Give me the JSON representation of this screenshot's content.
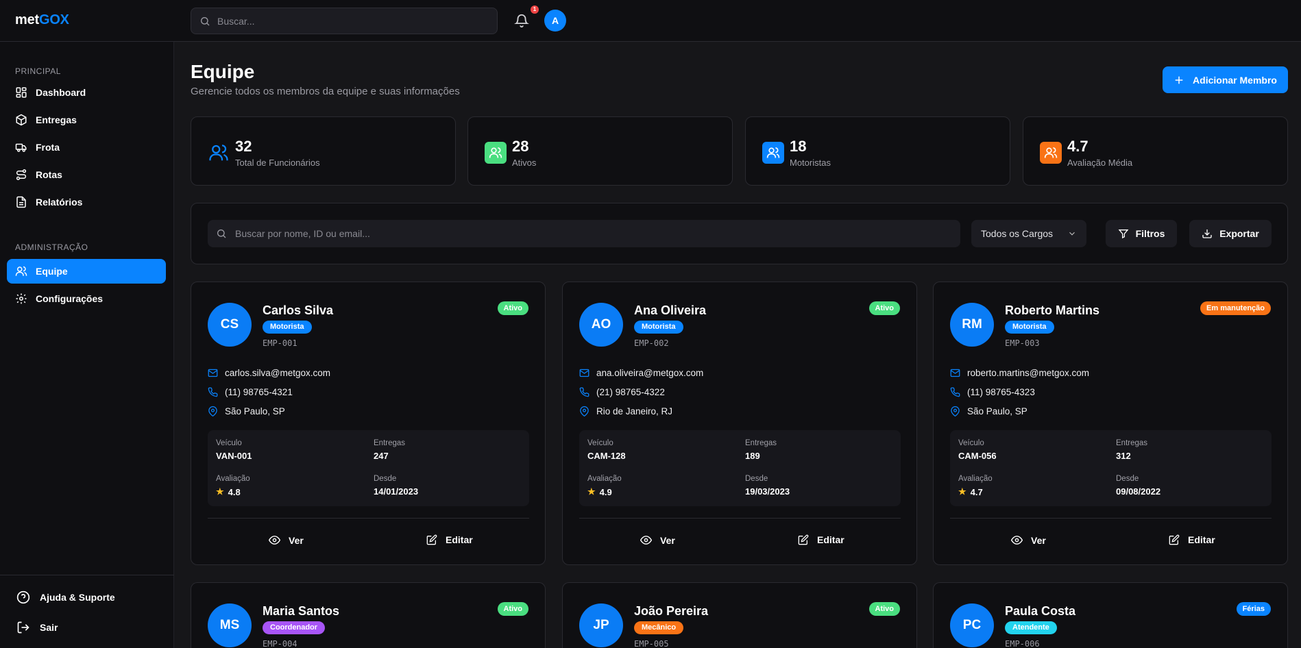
{
  "topbar": {
    "logo_prefix": "met",
    "logo_suffix": "GOX",
    "search_placeholder": "Buscar...",
    "notification_count": "1",
    "avatar_initial": "A"
  },
  "sidebar": {
    "section_principal": "PRINCIPAL",
    "section_admin": "ADMINISTRAÇÃO",
    "items": [
      {
        "label": "Dashboard",
        "icon": "dashboard-icon"
      },
      {
        "label": "Entregas",
        "icon": "package-icon"
      },
      {
        "label": "Frota",
        "icon": "truck-icon"
      },
      {
        "label": "Rotas",
        "icon": "route-icon"
      },
      {
        "label": "Relatórios",
        "icon": "report-icon"
      }
    ],
    "admin_items": [
      {
        "label": "Equipe",
        "icon": "users-icon",
        "active": true
      },
      {
        "label": "Configurações",
        "icon": "gear-icon"
      }
    ],
    "footer": {
      "help": "Ajuda & Suporte",
      "logout": "Sair"
    }
  },
  "page": {
    "title": "Equipe",
    "subtitle": "Gerencie todos os membros da equipe e suas informações",
    "add_button": "Adicionar Membro"
  },
  "stats": [
    {
      "value": "32",
      "label": "Total de Funcionários",
      "color": "#0a84ff"
    },
    {
      "value": "28",
      "label": "Ativos",
      "color": "#4ade80"
    },
    {
      "value": "18",
      "label": "Motoristas",
      "color": "#0a84ff"
    },
    {
      "value": "4.7",
      "label": "Avaliação Média",
      "color": "#f97316"
    }
  ],
  "filters": {
    "search_placeholder": "Buscar por nome, ID ou email...",
    "role_select": "Todos os Cargos",
    "filter_button": "Filtros",
    "export_button": "Exportar"
  },
  "labels": {
    "vehicle": "Veículo",
    "deliveries": "Entregas",
    "rating": "Avaliação",
    "since": "Desde",
    "view": "Ver",
    "edit": "Editar"
  },
  "members": [
    {
      "initials": "CS",
      "name": "Carlos Silva",
      "role": "Motorista",
      "role_color": "#0a84ff",
      "id": "EMP-001",
      "status": "Ativo",
      "status_color": "#4ade80",
      "email": "carlos.silva@metgox.com",
      "phone": "(11) 98765-4321",
      "location": "São Paulo, SP",
      "vehicle": "VAN-001",
      "deliveries": "247",
      "rating": "4.8",
      "since": "14/01/2023"
    },
    {
      "initials": "AO",
      "name": "Ana Oliveira",
      "role": "Motorista",
      "role_color": "#0a84ff",
      "id": "EMP-002",
      "status": "Ativo",
      "status_color": "#4ade80",
      "email": "ana.oliveira@metgox.com",
      "phone": "(21) 98765-4322",
      "location": "Rio de Janeiro, RJ",
      "vehicle": "CAM-128",
      "deliveries": "189",
      "rating": "4.9",
      "since": "19/03/2023"
    },
    {
      "initials": "RM",
      "name": "Roberto Martins",
      "role": "Motorista",
      "role_color": "#0a84ff",
      "id": "EMP-003",
      "status": "Em manutenção",
      "status_color": "#f97316",
      "email": "roberto.martins@metgox.com",
      "phone": "(11) 98765-4323",
      "location": "São Paulo, SP",
      "vehicle": "CAM-056",
      "deliveries": "312",
      "rating": "4.7",
      "since": "09/08/2022"
    },
    {
      "initials": "MS",
      "name": "Maria Santos",
      "role": "Coordenador",
      "role_color": "#a855f7",
      "id": "EMP-004",
      "status": "Ativo",
      "status_color": "#4ade80"
    },
    {
      "initials": "JP",
      "name": "João Pereira",
      "role": "Mecânico",
      "role_color": "#f97316",
      "id": "EMP-005",
      "status": "Ativo",
      "status_color": "#4ade80"
    },
    {
      "initials": "PC",
      "name": "Paula Costa",
      "role": "Atendente",
      "role_color": "#22d3ee",
      "id": "EMP-006",
      "status": "Férias",
      "status_color": "#0a84ff"
    }
  ]
}
